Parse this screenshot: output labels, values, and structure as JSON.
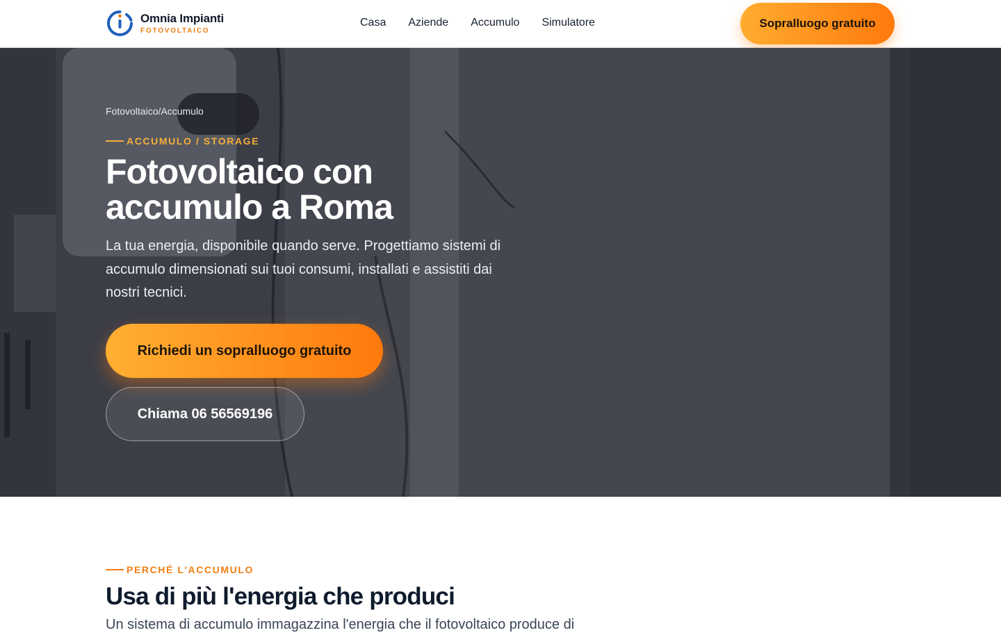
{
  "header": {
    "brand_name": "Omnia Impianti",
    "brand_sub": "FOTOVOLTAICO",
    "logo_icon": "omnia-ring-logo",
    "nav": [
      {
        "label": "Casa"
      },
      {
        "label": "Aziende"
      },
      {
        "label": "Accumulo"
      },
      {
        "label": "Simulatore"
      }
    ],
    "cta_label": "Sopralluogo gratuito"
  },
  "hero": {
    "breadcrumb": "Fotovoltaico/Accumulo",
    "eyebrow": "ACCUMULO / STORAGE",
    "title": "Fotovoltaico con accumulo a Roma",
    "text": "La tua energia, disponibile quando serve. Progettiamo sistemi di accumulo dimensionati sui tuoi consumi, installati e assistiti dai nostri tecnici.",
    "primary_cta": "Richiedi un sopralluogo gratuito",
    "secondary_cta": "Chiama 06 56569196"
  },
  "section": {
    "eyebrow": "PERCHÉ L'ACCUMULO",
    "title": "Usa di più l'energia che produci",
    "text": "Un sistema di accumulo immagazzina l'energia che il fotovoltaico produce di"
  },
  "colors": {
    "accent_orange": "#ff7a0c",
    "accent_amber": "#ffac2f",
    "brand_blue": "#1f5fb8",
    "text_dark": "#0f1b2d"
  }
}
